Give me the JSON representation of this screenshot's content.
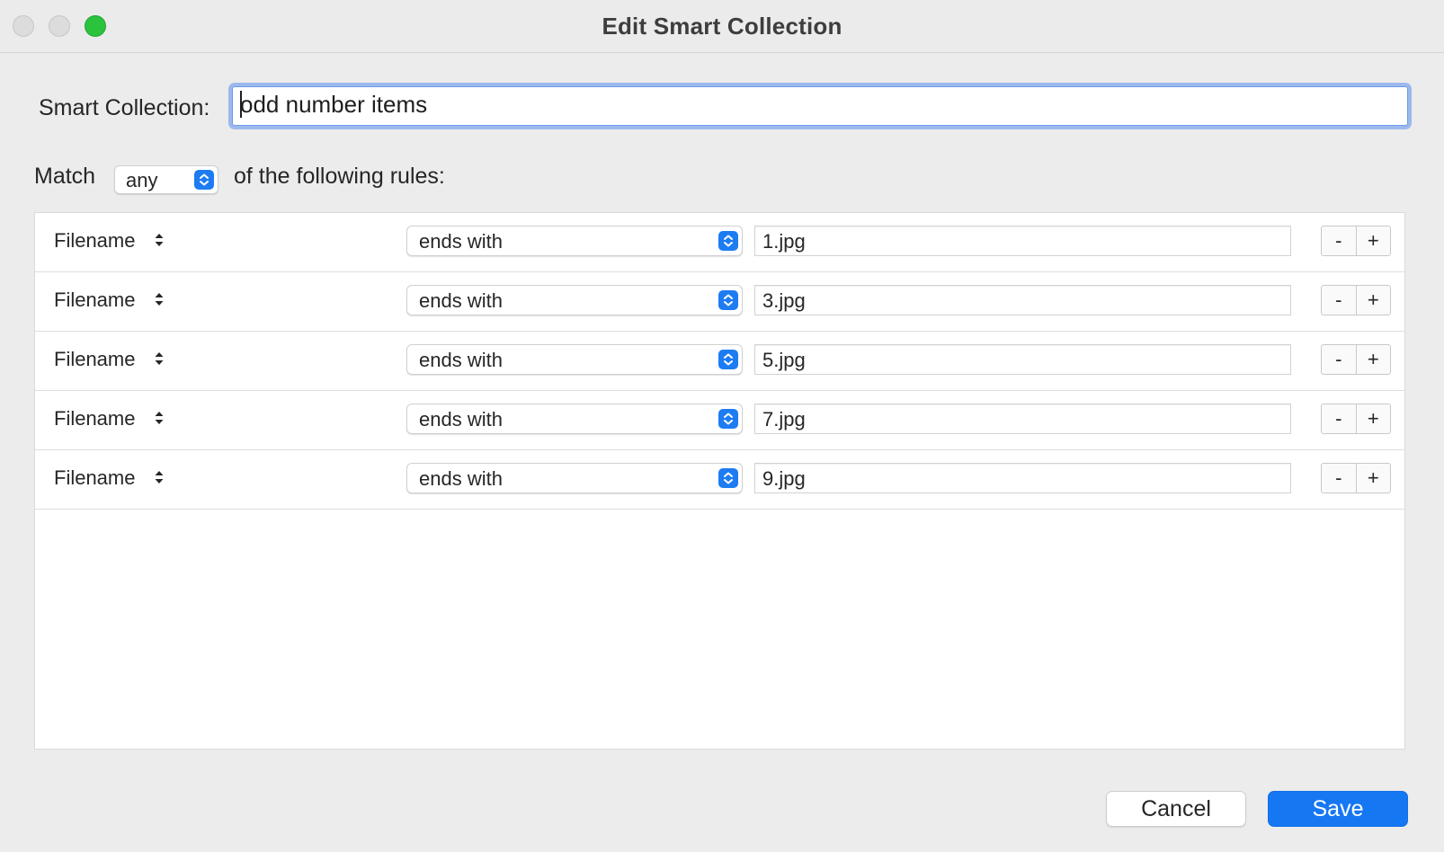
{
  "window": {
    "title": "Edit Smart Collection"
  },
  "collection": {
    "label": "Smart Collection:",
    "name": "odd number items"
  },
  "match": {
    "prefix": "Match",
    "mode": "any",
    "suffix": "of the following rules:"
  },
  "rules": [
    {
      "field": "Filename",
      "operator": "ends with",
      "value": "1.jpg"
    },
    {
      "field": "Filename",
      "operator": "ends with",
      "value": "3.jpg"
    },
    {
      "field": "Filename",
      "operator": "ends with",
      "value": "5.jpg"
    },
    {
      "field": "Filename",
      "operator": "ends with",
      "value": "7.jpg"
    },
    {
      "field": "Filename",
      "operator": "ends with",
      "value": "9.jpg"
    }
  ],
  "rule_buttons": {
    "remove": "-",
    "add": "+"
  },
  "footer": {
    "cancel": "Cancel",
    "save": "Save"
  },
  "colors": {
    "accent": "#1677f3",
    "zoom": "#2bc33e",
    "focus_ring": "#9cb9ee"
  }
}
